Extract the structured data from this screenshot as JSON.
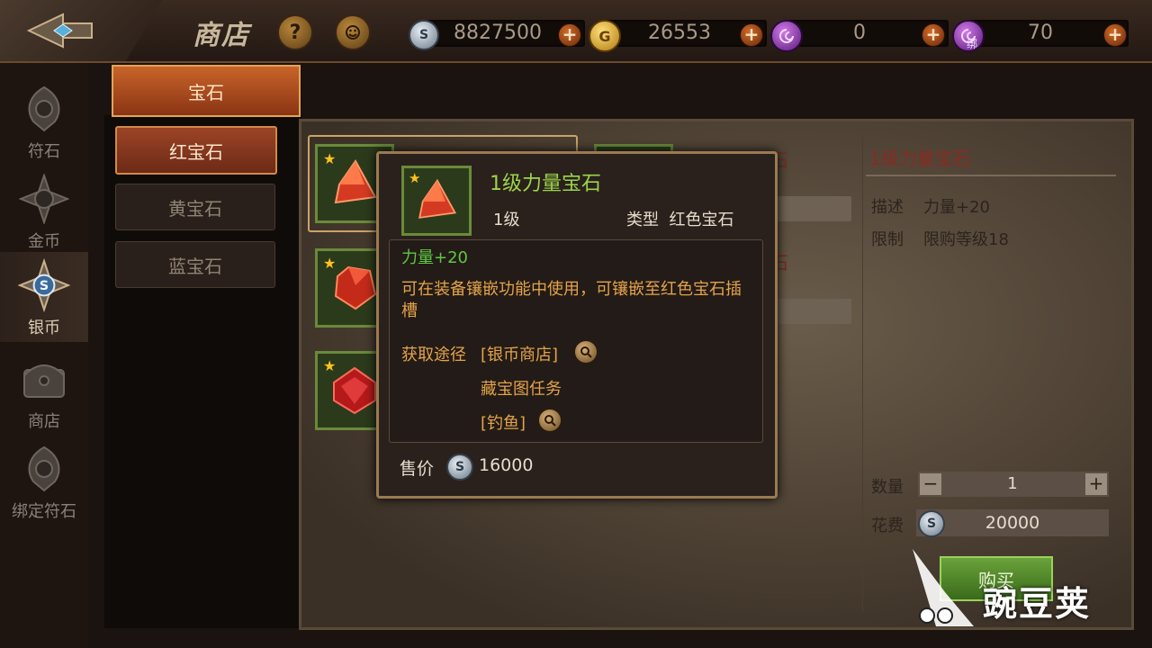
{
  "header": {
    "title": "商店",
    "help_icon": "question-icon",
    "service_icon": "headset-icon"
  },
  "currencies": [
    {
      "name": "silver",
      "icon": "silver-coin-icon",
      "value": "8827500"
    },
    {
      "name": "gold",
      "icon": "gold-coin-icon",
      "value": "26553"
    },
    {
      "name": "rune",
      "icon": "purple-rune-icon",
      "value": "0"
    },
    {
      "name": "bound_rune",
      "icon": "bound-rune-icon",
      "badge": "绑",
      "value": "70"
    }
  ],
  "plus_symbol": "+",
  "nav": [
    {
      "label": "符石",
      "icon": "rune-stone-icon",
      "active": false
    },
    {
      "label": "金币",
      "icon": "gold-emblem-icon",
      "active": false
    },
    {
      "label": "银币",
      "icon": "silver-emblem-icon",
      "active": true
    },
    {
      "label": "商店",
      "icon": "chest-icon",
      "active": false
    },
    {
      "label": "绑定符石",
      "icon": "bound-rune-emblem-icon",
      "active": false
    }
  ],
  "category": {
    "tab": "宝石",
    "subcategories": [
      {
        "label": "红宝石",
        "active": true
      },
      {
        "label": "黄宝石",
        "active": false
      },
      {
        "label": "蓝宝石",
        "active": false
      }
    ]
  },
  "grid_bg_text": [
    "石",
    "石"
  ],
  "detail": {
    "title": "1级力量宝石",
    "desc_label": "描述",
    "desc_value": "力量+20",
    "limit_label": "限制",
    "limit_value": "限购等级18",
    "qty_label": "数量",
    "qty_value": "1",
    "minus": "−",
    "plus": "+",
    "cost_label": "花费",
    "cost_value": "20000",
    "buy_label": "购买"
  },
  "tooltip": {
    "name": "1级力量宝石",
    "level": "1级",
    "type_label": "类型",
    "type_value": "红色宝石",
    "stat": "力量+20",
    "desc": "可在装备镶嵌功能中使用，可镶嵌至红色宝石插槽",
    "source_label": "获取途径",
    "sources": [
      "[银币商店]",
      "藏宝图任务",
      "[钓鱼]"
    ],
    "price_label": "售价",
    "price_value": "16000"
  },
  "watermark": {
    "text": "豌豆荚"
  },
  "colors": {
    "accent_orange": "#c8642a",
    "item_green": "#6a8a3a",
    "name_green": "#9cd44a",
    "stat_green": "#5ec840",
    "desc_orange": "#e3a34a",
    "title_red": "#8a2a22"
  }
}
